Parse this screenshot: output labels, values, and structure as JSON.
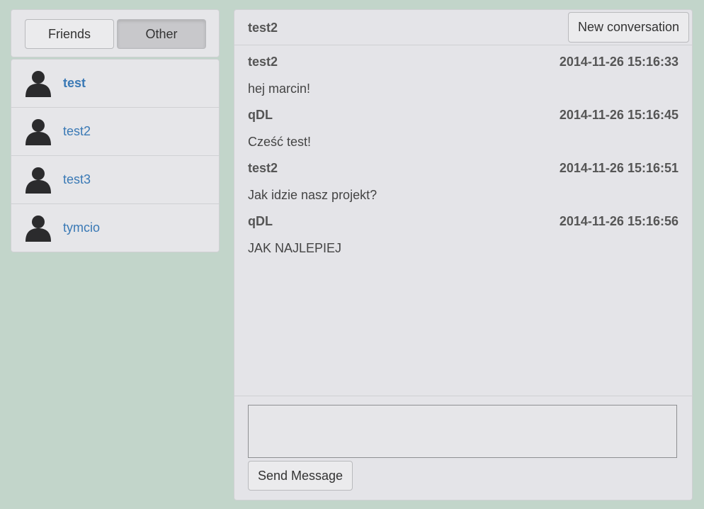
{
  "tabs": {
    "friends_label": "Friends",
    "other_label": "Other",
    "active": "Other"
  },
  "contacts": [
    {
      "name": "test",
      "icon": "user-icon",
      "active": true
    },
    {
      "name": "test2",
      "icon": "user-icon",
      "active": false
    },
    {
      "name": "test3",
      "icon": "user-icon",
      "active": false
    },
    {
      "name": "tymcio",
      "icon": "user-icon",
      "active": false
    }
  ],
  "chat": {
    "title": "test2",
    "new_conversation_label": "New conversation",
    "messages": [
      {
        "author": "test2",
        "time": "2014-11-26 15:16:33",
        "text": "hej marcin!"
      },
      {
        "author": "qDL",
        "time": "2014-11-26 15:16:45",
        "text": "Cześć test!"
      },
      {
        "author": "test2",
        "time": "2014-11-26 15:16:51",
        "text": "Jak idzie nasz projekt?"
      },
      {
        "author": "qDL",
        "time": "2014-11-26 15:16:56",
        "text": "JAK NAJLEPIEJ"
      }
    ],
    "input_value": "",
    "send_label": "Send Message"
  },
  "colors": {
    "background": "#c2d5ca",
    "panel": "#e4e4e8",
    "link": "#3a79b5"
  }
}
